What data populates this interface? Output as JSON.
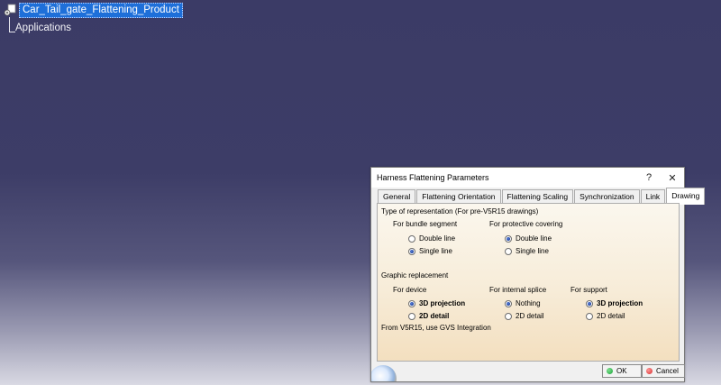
{
  "tree": {
    "root_label": "Car_Tail_gate_Flattening_Product",
    "child_label": "Applications"
  },
  "dialog": {
    "title": "Harness Flattening Parameters",
    "help_glyph": "?",
    "close_glyph": "✕",
    "tabs": [
      {
        "label": "General"
      },
      {
        "label": "Flattening Orientation"
      },
      {
        "label": "Flattening Scaling"
      },
      {
        "label": "Synchronization"
      },
      {
        "label": "Link"
      },
      {
        "label": "Drawing"
      }
    ],
    "active_tab": "Drawing",
    "drawing": {
      "representation_heading": "Type of representation (For pre-V5R15 drawings)",
      "bundle_segment": {
        "label": "For bundle segment",
        "options": [
          "Double line",
          "Single line"
        ],
        "selected": "Single line"
      },
      "protective_covering": {
        "label": "For protective covering",
        "options": [
          "Double line",
          "Single line"
        ],
        "selected": "Double line"
      },
      "graphic_heading": "Graphic replacement",
      "device": {
        "label": "For device",
        "options": [
          "3D projection",
          "2D detail"
        ],
        "selected": "3D projection"
      },
      "internal_splice": {
        "label": "For internal splice",
        "options": [
          "Nothing",
          "2D detail"
        ],
        "selected": "Nothing"
      },
      "support": {
        "label": "For support",
        "options": [
          "3D projection",
          "2D detail"
        ],
        "selected": "3D projection"
      },
      "note": "From V5R15, use GVS Integration"
    },
    "ok_label": "OK",
    "cancel_label": "Cancel"
  },
  "colors": {
    "selection": "#1e6fd9",
    "ok_icon": "#1aa33a",
    "cancel_icon": "#d62b2b",
    "radio_fill": "#0b2f8a"
  }
}
